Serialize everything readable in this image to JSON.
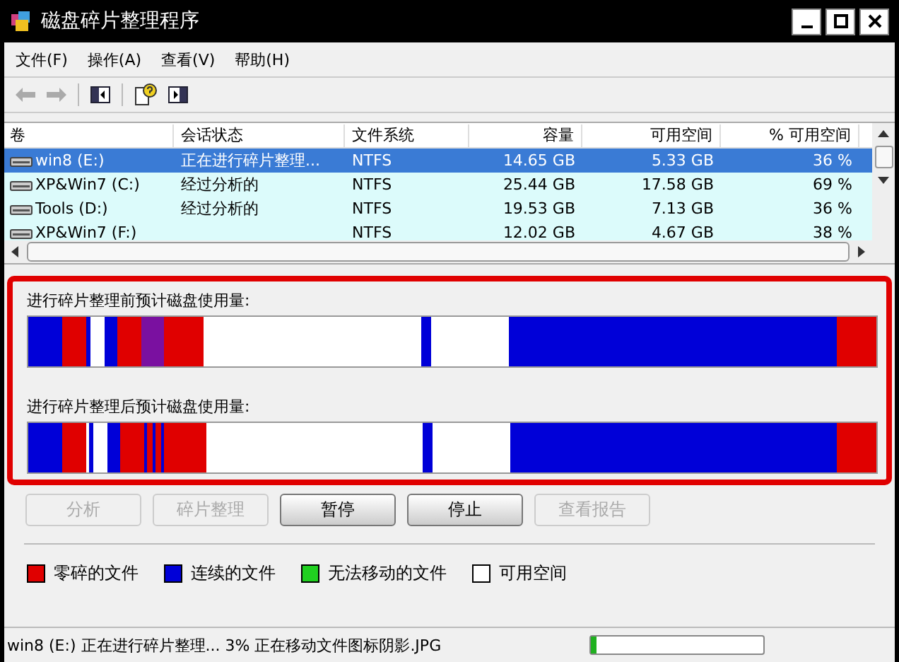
{
  "window": {
    "title": "磁盘碎片整理程序"
  },
  "menu": [
    "文件(F)",
    "操作(A)",
    "查看(V)",
    "帮助(H)"
  ],
  "volumes": {
    "columns": [
      "卷",
      "会话状态",
      "文件系统",
      "容量",
      "可用空间",
      "% 可用空间"
    ],
    "rows": [
      {
        "name": "win8 (E:)",
        "status": "正在进行碎片整理...",
        "fs": "NTFS",
        "capacity": "14.65 GB",
        "free": "5.33 GB",
        "pct": "36 %",
        "selected": true
      },
      {
        "name": "XP&Win7 (C:)",
        "status": "经过分析的",
        "fs": "NTFS",
        "capacity": "25.44 GB",
        "free": "17.58 GB",
        "pct": "69 %",
        "selected": false
      },
      {
        "name": "Tools (D:)",
        "status": "经过分析的",
        "fs": "NTFS",
        "capacity": "19.53 GB",
        "free": "7.13 GB",
        "pct": "36 %",
        "selected": false
      },
      {
        "name": "XP&Win7 (F:)",
        "status": "",
        "fs": "NTFS",
        "capacity": "12.02 GB",
        "free": "4.67 GB",
        "pct": "38 %",
        "selected": false
      }
    ]
  },
  "maps": [
    {
      "label": "进行碎片整理前预计磁盘使用量:",
      "kind": "before"
    },
    {
      "label": "进行碎片整理后预计磁盘使用量:",
      "kind": "after"
    }
  ],
  "buttons": [
    {
      "label": "分析",
      "disabled": true
    },
    {
      "label": "碎片整理",
      "disabled": true
    },
    {
      "label": "暂停",
      "disabled": false
    },
    {
      "label": "停止",
      "disabled": false
    },
    {
      "label": "查看报告",
      "disabled": true
    }
  ],
  "legend": [
    {
      "label": "零碎的文件",
      "color": "#e00000"
    },
    {
      "label": "连续的文件",
      "color": "#0000d8"
    },
    {
      "label": "无法移动的文件",
      "color": "#20d020"
    },
    {
      "label": "可用空间",
      "color": "#ffffff"
    }
  ],
  "status_bar": {
    "text": "win8 (E:) 正在进行碎片整理... 3%  正在移动文件图标阴影.JPG",
    "level": 0.03
  }
}
